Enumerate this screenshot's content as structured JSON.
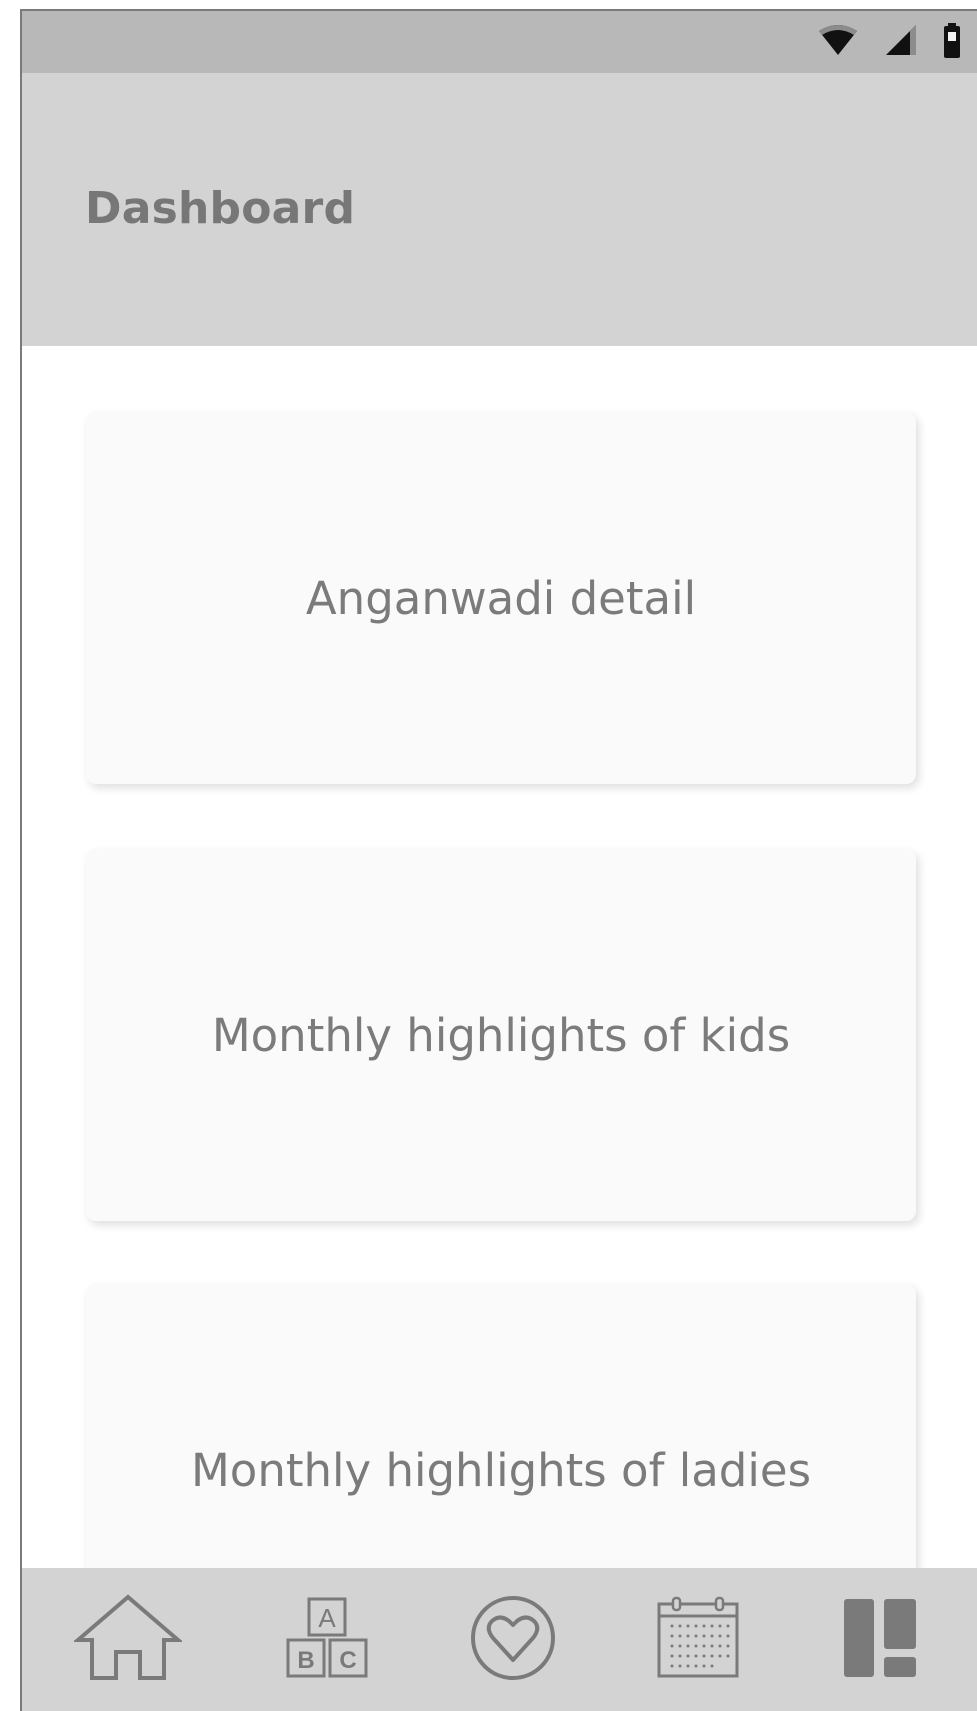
{
  "status_bar": {
    "icons": [
      "wifi-icon",
      "cellular-signal-icon",
      "battery-icon"
    ]
  },
  "app_bar": {
    "title": "Dashboard"
  },
  "cards": [
    {
      "label": "Anganwadi detail"
    },
    {
      "label": "Monthly highlights of kids"
    },
    {
      "label": "Monthly highlights of ladies"
    }
  ],
  "bottom_nav": {
    "items": [
      {
        "icon": "home-icon"
      },
      {
        "icon": "abc-blocks-icon"
      },
      {
        "icon": "heart-icon"
      },
      {
        "icon": "calendar-icon"
      },
      {
        "icon": "dashboard-icon",
        "selected": true
      }
    ]
  },
  "colors": {
    "status_bar": "#b8b8b8",
    "app_bar": "#d3d3d3",
    "title_text": "#777777",
    "card_background": "#fafafa",
    "card_text": "#7b7b7b",
    "icon_stroke": "#7a7a7a"
  }
}
